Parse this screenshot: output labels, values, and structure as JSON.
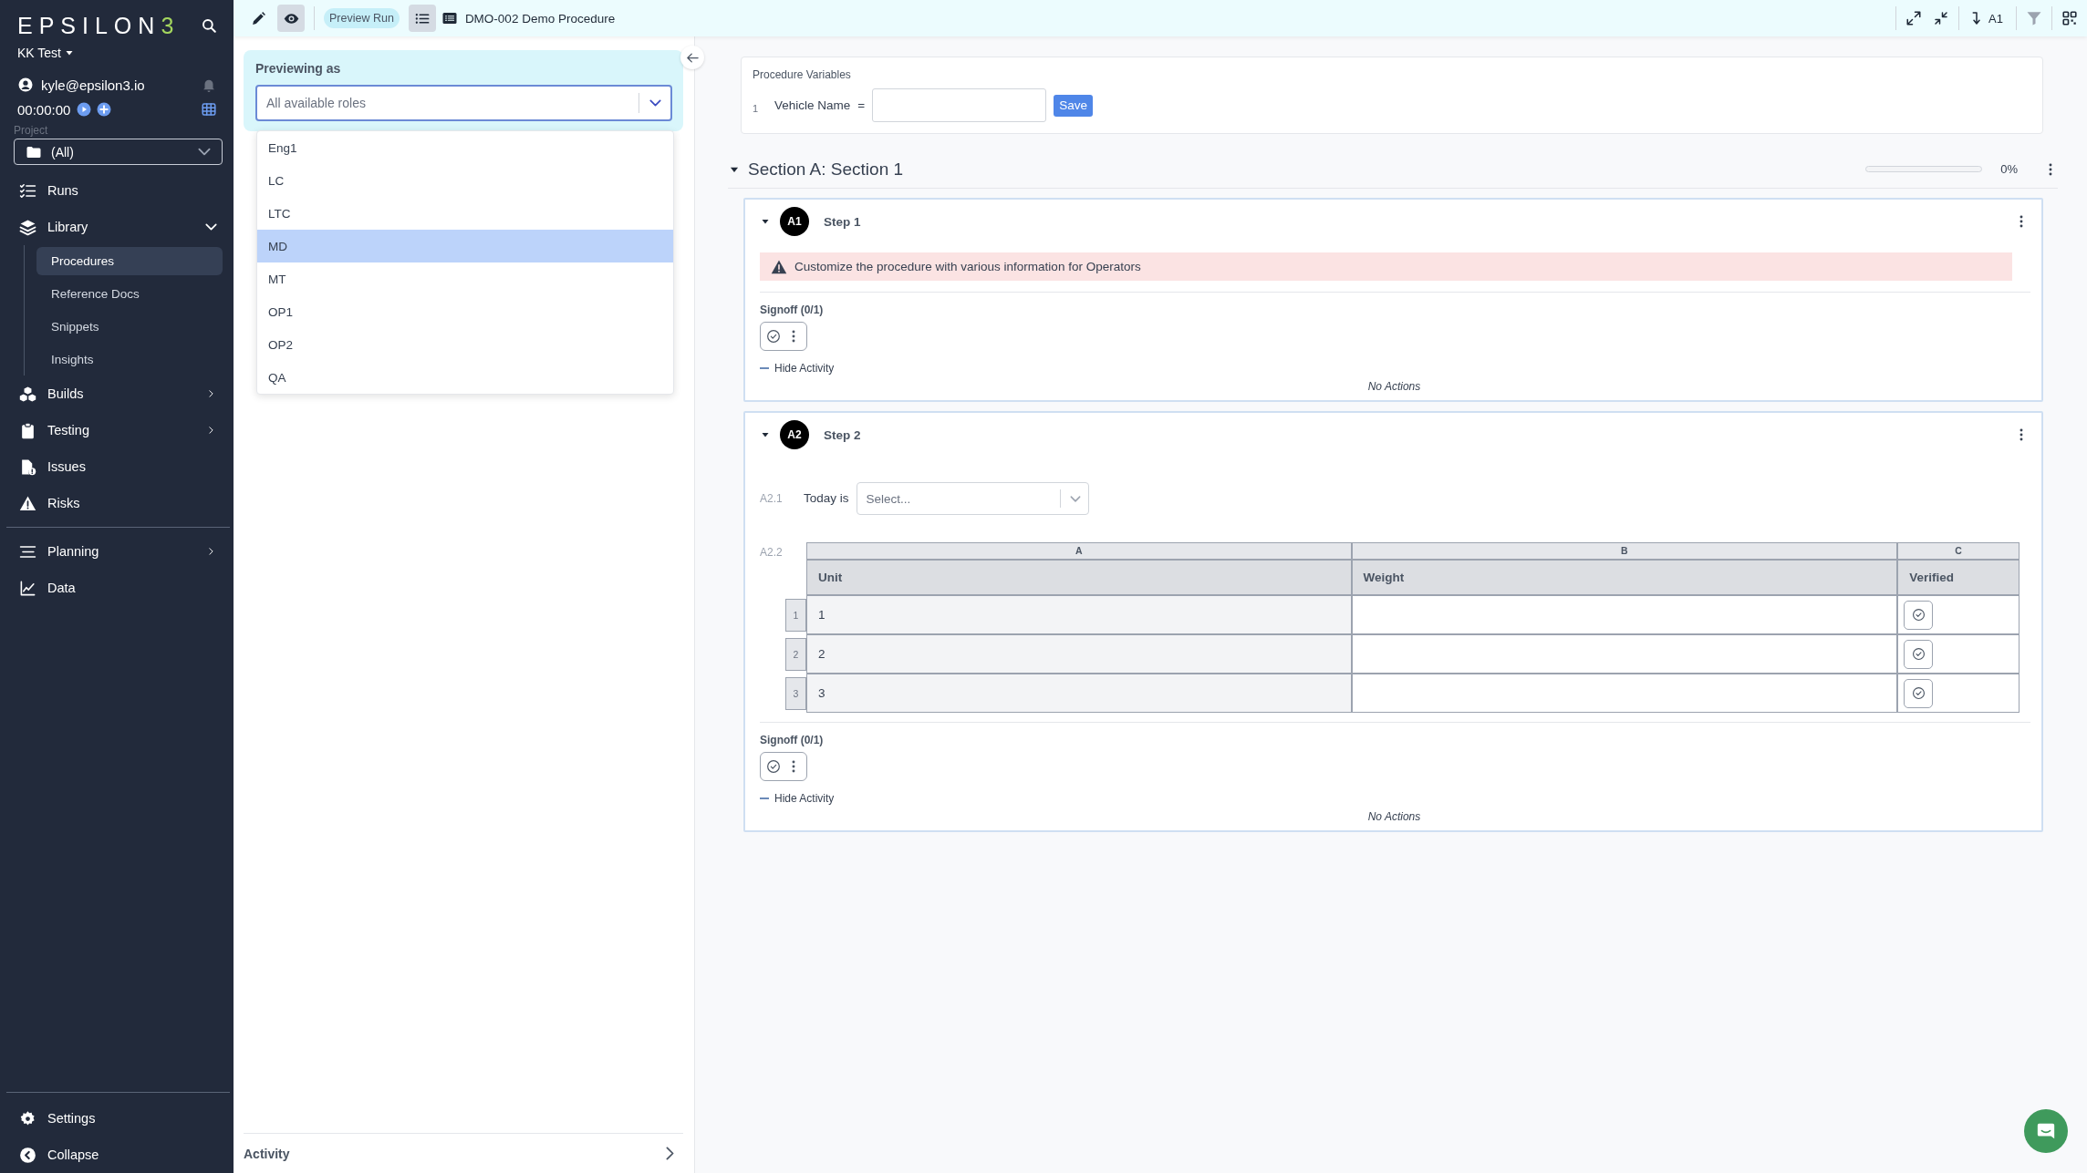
{
  "sidebar": {
    "logo": {
      "text": "EPSILON",
      "accent": "3"
    },
    "workspace": "KK Test",
    "user": "kyle@epsilon3.io",
    "timer": "00:00:00",
    "project_label": "Project",
    "project": "(All)",
    "nav": [
      {
        "label": "Runs",
        "kind": "link",
        "selected": false
      },
      {
        "label": "Library",
        "kind": "group",
        "expanded": true,
        "selected": false,
        "children": [
          {
            "label": "Procedures",
            "selected": true
          },
          {
            "label": "Reference Docs",
            "selected": false
          },
          {
            "label": "Snippets",
            "selected": false
          },
          {
            "label": "Insights",
            "selected": false
          }
        ]
      },
      {
        "label": "Builds",
        "kind": "group",
        "expanded": false,
        "selected": false
      },
      {
        "label": "Testing",
        "kind": "group",
        "expanded": false,
        "selected": false
      },
      {
        "label": "Issues",
        "kind": "link",
        "selected": false
      },
      {
        "label": "Risks",
        "kind": "link",
        "selected": false
      },
      {
        "label": "Planning",
        "kind": "group",
        "expanded": false,
        "selected": false
      },
      {
        "label": "Data",
        "kind": "link",
        "selected": false
      }
    ],
    "footer": [
      {
        "label": "Settings"
      },
      {
        "label": "Collapse"
      }
    ]
  },
  "toolbar": {
    "modes": [
      {
        "kind": "edit",
        "selected": false
      },
      {
        "kind": "preview",
        "selected": true
      }
    ],
    "badge": "Preview Run",
    "outline_open": true,
    "title": "DMO-002 Demo Procedure",
    "jump_label": "A1"
  },
  "preview_panel": {
    "heading": "Previewing as",
    "placeholder": "All available roles",
    "options": [
      {
        "label": "Eng1",
        "selected": false
      },
      {
        "label": "LC",
        "selected": false
      },
      {
        "label": "LTC",
        "selected": false
      },
      {
        "label": "MD",
        "selected": true
      },
      {
        "label": "MT",
        "selected": false
      },
      {
        "label": "OP1",
        "selected": false
      },
      {
        "label": "OP2",
        "selected": false
      },
      {
        "label": "QA",
        "selected": false
      }
    ],
    "footer": "Activity"
  },
  "procedure": {
    "variables": {
      "title": "Procedure Variables",
      "rows": [
        {
          "index": "1",
          "name": "Vehicle Name",
          "operator": "=",
          "button": "Save"
        }
      ]
    },
    "section": {
      "title": "Section A: Section 1",
      "expanded": true,
      "level": 0,
      "reading": "0%",
      "steps": [
        {
          "badge": "A1",
          "title": "Step 1",
          "expanded": true,
          "content": [
            {
              "kind": "alert",
              "text": "Customize the procedure with various information for Operators"
            }
          ],
          "signoff": "Signoff (0/1)",
          "activity_toggle": "Hide Activity",
          "activity_empty": "No Actions"
        },
        {
          "badge": "A2",
          "title": "Step 2",
          "expanded": true,
          "content": [
            {
              "kind": "select",
              "index": "A2.1",
              "label": "Today is",
              "placeholder": "Select..."
            },
            {
              "kind": "table",
              "index": "A2.2",
              "letters": [
                "A",
                "B",
                "C"
              ],
              "columns": [
                "Unit",
                "Weight",
                "Verified"
              ],
              "rows": [
                {
                  "number": "1",
                  "cells": [
                    "1"
                  ]
                },
                {
                  "number": "2",
                  "cells": [
                    "2"
                  ]
                },
                {
                  "number": "3",
                  "cells": [
                    "3"
                  ]
                }
              ]
            }
          ],
          "signoff": "Signoff (0/1)",
          "activity_toggle": "Hide Activity",
          "activity_empty": "No Actions"
        }
      ]
    }
  }
}
